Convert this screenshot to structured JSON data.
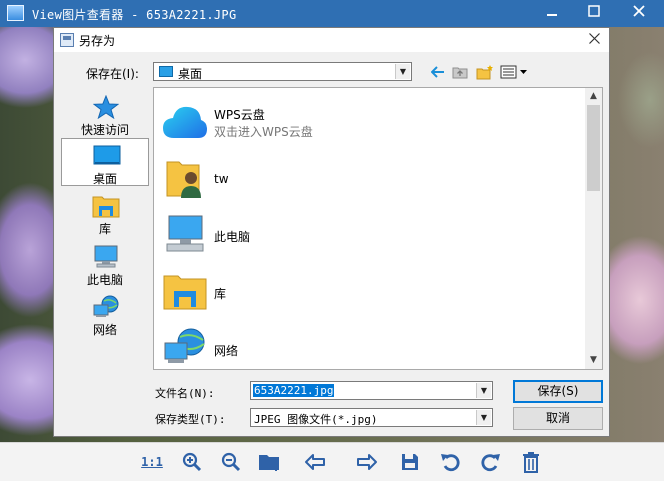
{
  "app": {
    "title": "View图片查看器 - 653A2221.JPG",
    "window_buttons": [
      "minimize",
      "maximize",
      "close"
    ]
  },
  "dialog": {
    "title": "另存为",
    "save_in_label": "保存在(I):",
    "save_in_value": "桌面",
    "places": [
      {
        "label": "快速访问",
        "icon": "star-icon"
      },
      {
        "label": "桌面",
        "icon": "desktop-icon",
        "selected": true
      },
      {
        "label": "库",
        "icon": "library-icon"
      },
      {
        "label": "此电脑",
        "icon": "computer-icon"
      },
      {
        "label": "网络",
        "icon": "network-icon"
      }
    ],
    "files": [
      {
        "name": "WPS云盘",
        "sub": "双击进入WPS云盘",
        "icon": "cloud-icon"
      },
      {
        "name": "tw",
        "icon": "user-folder-icon"
      },
      {
        "name": "此电脑",
        "icon": "computer-icon"
      },
      {
        "name": "库",
        "icon": "library-icon"
      },
      {
        "name": "网络",
        "icon": "network-icon"
      }
    ],
    "filename_label": "文件名(N):",
    "filename_value": "653A2221.jpg",
    "filetype_label": "保存类型(T):",
    "filetype_value": "JPEG 图像文件(*.jpg)",
    "save_button": "保存(S)",
    "cancel_button": "取消"
  },
  "toolbar": {
    "actual_size_label": "1:1",
    "tools": [
      "zoom-in-icon",
      "zoom-out-icon",
      "folder-icon",
      "previous-icon",
      "next-icon",
      "save-icon",
      "rotate-left-icon",
      "rotate-right-icon",
      "delete-icon"
    ]
  },
  "colors": {
    "titlebar": "#2f6fb3",
    "accent": "#0078d7",
    "toolbar_icons": "#2f62a8"
  }
}
